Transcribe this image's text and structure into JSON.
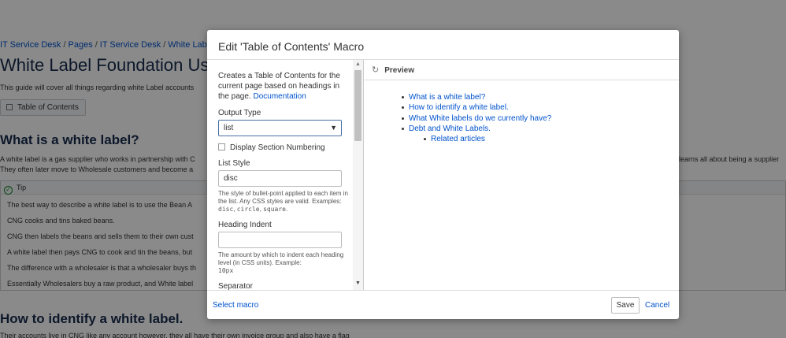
{
  "background": {
    "breadcrumb": [
      "IT Service Desk",
      "Pages",
      "IT Service Desk",
      "White Label Foun"
    ],
    "breadcrumb_sep": "/",
    "title": "White Label Foundation User G",
    "intro": "This guide will cover all things regarding white Label accounts",
    "toc_button": "Table of Contents",
    "heading_what": "What is a white label?",
    "para1": "A white label is a gas supplier who works in partnership with C",
    "para1_right": "learns all about being a supplier",
    "para2": "They often later move to Wholesale customers and become a",
    "tip_label": "Tip",
    "tip_lines": [
      "The best way to describe a white label is to use the Bean A",
      "CNG cooks and tins baked beans.",
      "CNG then labels the beans and sells them to their own cust",
      "A white label then pays CNG to cook and tin the beans, but",
      "The difference with a wholesaler is that a wholesaler buys th",
      "Essentially Wholesalers buy a raw product, and White label"
    ],
    "heading_how": "How to identify a white label.",
    "last_line": "Their accounts live in CNG like any account however, they all have their own invoice group and also have a flag"
  },
  "dialog": {
    "title": "Edit 'Table of Contents' Macro",
    "description": "Creates a Table of Contents for the current page based on headings in the page.",
    "documentation_link": "Documentation",
    "output_type_label": "Output Type",
    "output_type_value": "list",
    "display_numbering_label": "Display Section Numbering",
    "list_style_label": "List Style",
    "list_style_value": "disc",
    "list_style_help": "The style of bullet-point applied to each item in the list. Any CSS styles are valid. Examples:",
    "list_style_examples": [
      "disc",
      "circle",
      "square"
    ],
    "heading_indent_label": "Heading Indent",
    "heading_indent_value": "",
    "heading_indent_help": "The amount by which to indent each heading level (in CSS units). Example:",
    "heading_indent_example": "10px",
    "separator_label": "Separator",
    "preview_label": "Preview",
    "preview_items": [
      "What is a white label?",
      "How to identify a white label.",
      "What White labels do we currently have?",
      "Debt and White Labels."
    ],
    "preview_subitems": [
      "Related articles"
    ],
    "select_macro": "Select macro",
    "save": "Save",
    "cancel": "Cancel"
  }
}
